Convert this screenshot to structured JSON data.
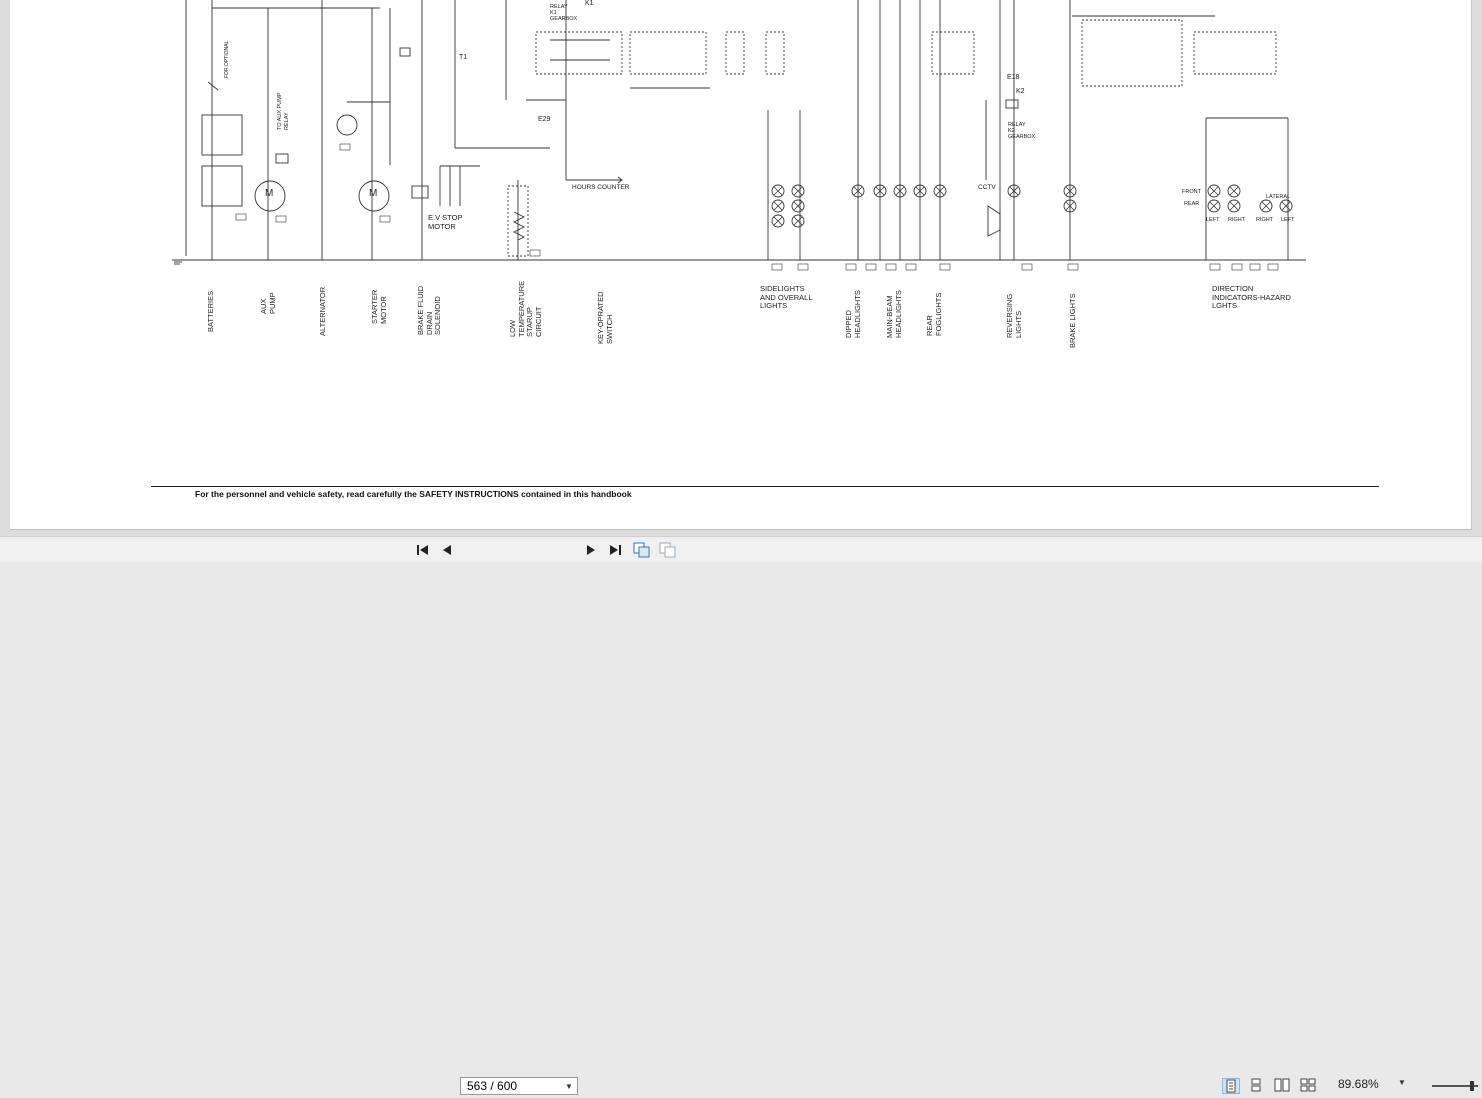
{
  "document": {
    "component_labels": {
      "batteries": "BATTERIES",
      "aux_pump": "AUX\nPUMP",
      "alternator": "ALTERNATOR",
      "starter_motor": "STARTER\nMOTOR",
      "brake_fluid": "BRAKE FLUID\nDRAIN\nSOLENOID",
      "low_temp": "LOW\nTEMPERATURE\nSTARUP\nCIRCUIT",
      "key_switch": "KEY-OPRATED\nSWITCH",
      "sidelights": "SIDELIGHTS\nAND OVERALL\nLIGHTS",
      "dipped": "DIPPED\nHEADLIGHTS",
      "main_beam": "MAIN-BEAM\nHEADLIGHTS",
      "rear_fog": "REAR\nFOGLIGHTS",
      "reversing": "REVERSING\nLIGHTS",
      "brake_lights": "BRAKE LIGHTS",
      "direction": "DIRECTION\nINDICATORS-HAZARD\nLGHTS"
    },
    "annotations": {
      "ev_stop": "E.V STOP\nMOTOR",
      "hours_counter": "HOURS COUNTER",
      "cctv": "CCTV",
      "e18": "E18",
      "k2": "K2",
      "e29": "E29",
      "t1": "T1",
      "k1": "K1",
      "relay_k1": "RELAY\nK1\nGEARBOX",
      "relay_k2": "RELAY\nK2\nGEARBOX",
      "to_aux_pump": "TO AUX PUMP\nRELAY",
      "for_optional": "FOR OPTIONAL",
      "front": "FRONT",
      "rear": "REAR",
      "lateral": "LATERAL",
      "left1": "LEFT",
      "right1": "RIGHT",
      "right2": "RIGHT",
      "left2": "LEFT",
      "motor_m": "M"
    },
    "footer": "For the personnel and vehicle safety, read carefully the SAFETY INSTRUCTIONS contained in this handbook"
  },
  "toolbar": {
    "page_value": "563 / 600",
    "zoom": "89.68%",
    "icons": [
      "first-page-icon",
      "prev-page-icon",
      "next-page-icon",
      "last-page-icon",
      "copy-icon",
      "fit-icon",
      "single-page-icon",
      "continuous-icon",
      "facing-icon",
      "continuous-facing-icon",
      "zoom-dropdown-icon"
    ]
  }
}
